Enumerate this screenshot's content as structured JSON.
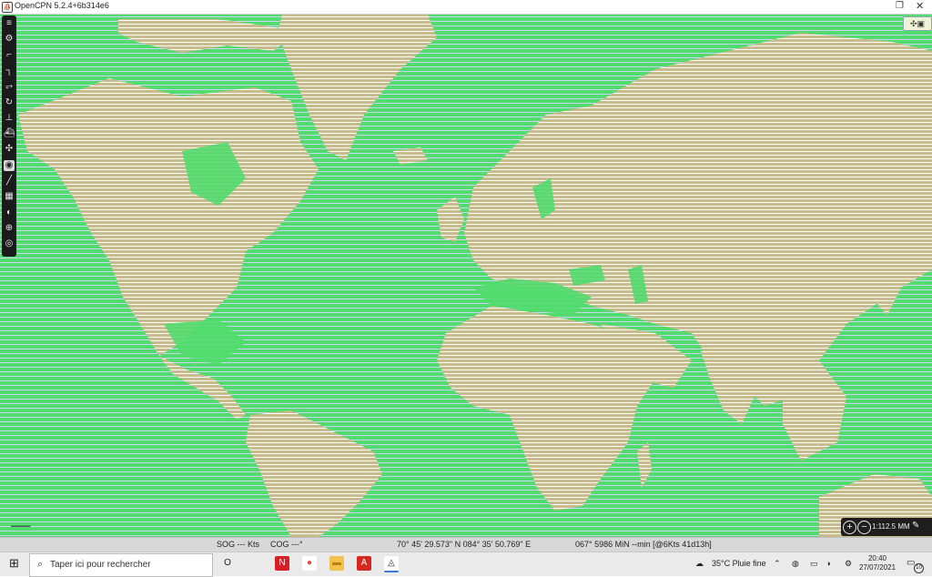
{
  "window": {
    "title": "OpenCPN 5.2.4+6b314e6"
  },
  "toolbar": {
    "tools": [
      {
        "name": "menu-icon",
        "glyph": "≡"
      },
      {
        "name": "settings-icon",
        "glyph": "⚙"
      },
      {
        "name": "route-icon",
        "glyph": "⌐"
      },
      {
        "name": "track-icon",
        "glyph": "┐"
      },
      {
        "name": "ais-icon",
        "glyph": "⥅"
      },
      {
        "name": "tide-icon",
        "glyph": "↻"
      },
      {
        "name": "current-icon",
        "glyph": "⊥"
      },
      {
        "name": "ship-icon",
        "glyph": "⛴"
      },
      {
        "name": "compass-rose-icon",
        "glyph": "✣"
      },
      {
        "name": "follow-icon",
        "glyph": "◉"
      },
      {
        "name": "ruler-icon",
        "glyph": "╱"
      },
      {
        "name": "gps-icon",
        "glyph": "▦"
      },
      {
        "name": "globe-icon",
        "glyph": "◐"
      },
      {
        "name": "mob-icon",
        "glyph": "⊕"
      },
      {
        "name": "lifebuoy-icon",
        "glyph": "◎"
      }
    ],
    "selected_index": 9
  },
  "map": {
    "land_color": "#c8bc8c",
    "water_color": "#52dc6e",
    "stripe_color": "#c9d3f2"
  },
  "zoom": {
    "zoom_in_label": "+",
    "zoom_out_label": "−",
    "scale": "1:112.5 MM"
  },
  "statusbar": {
    "sog": "SOG --- Kts",
    "cog": "COG ---°",
    "position": "70° 45' 29.573\" N   084° 35' 50.769\" E",
    "cursor_info": "067°  5986 MiN --min [@6Kts 41d13h]"
  },
  "taskbar": {
    "search_placeholder": "Taper ici pour rechercher",
    "apps": [
      {
        "name": "task-view-icon",
        "glyph": "O",
        "color": "transparent",
        "text_color": "#222"
      },
      {
        "name": "netflix-icon",
        "glyph": "N",
        "color": "#d81f26",
        "text_color": "#fff"
      },
      {
        "name": "chrome-icon",
        "glyph": "●",
        "color": "#ffffff",
        "text_color": "#e8453c"
      },
      {
        "name": "file-explorer-icon",
        "glyph": "▬",
        "color": "#f2c14e",
        "text_color": "#b8860b"
      },
      {
        "name": "acrobat-icon",
        "glyph": "A",
        "color": "#d6281f",
        "text_color": "#fff"
      },
      {
        "name": "opencpn-icon",
        "glyph": "◬",
        "color": "#ffffff",
        "text_color": "#333"
      }
    ],
    "weather": "35°C  Pluie fine",
    "time": "20:40",
    "date": "27/07/2021",
    "notifications": "10"
  }
}
